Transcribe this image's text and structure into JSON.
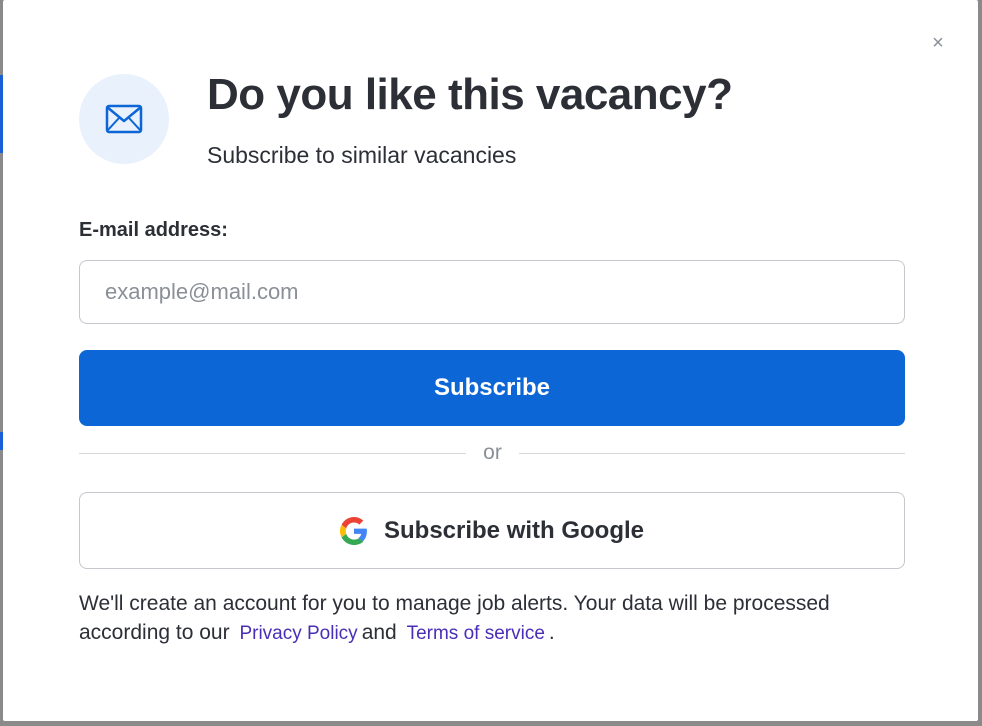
{
  "modal": {
    "close_symbol": "×",
    "icon": "envelope-icon",
    "title": "Do you like this vacancy?",
    "subtitle": "Subscribe to similar vacancies"
  },
  "form": {
    "email_label": "E-mail address:",
    "email_placeholder": "example@mail.com",
    "email_value": "",
    "subscribe_label": "Subscribe",
    "divider_text": "or",
    "google_label": "Subscribe with Google",
    "google_icon": "google-icon"
  },
  "disclaimer": {
    "text_before": "We'll create an account for you to manage job alerts. Your data will be processed according to our",
    "privacy_link": "Privacy Policy",
    "conjunction": "and",
    "terms_link": "Terms of service",
    "end": "."
  },
  "colors": {
    "primary": "#0c66d6",
    "icon_circle": "#e8f1fc",
    "link": "#4a2fb6",
    "text": "#2c2f36",
    "muted": "#8a8f98"
  }
}
